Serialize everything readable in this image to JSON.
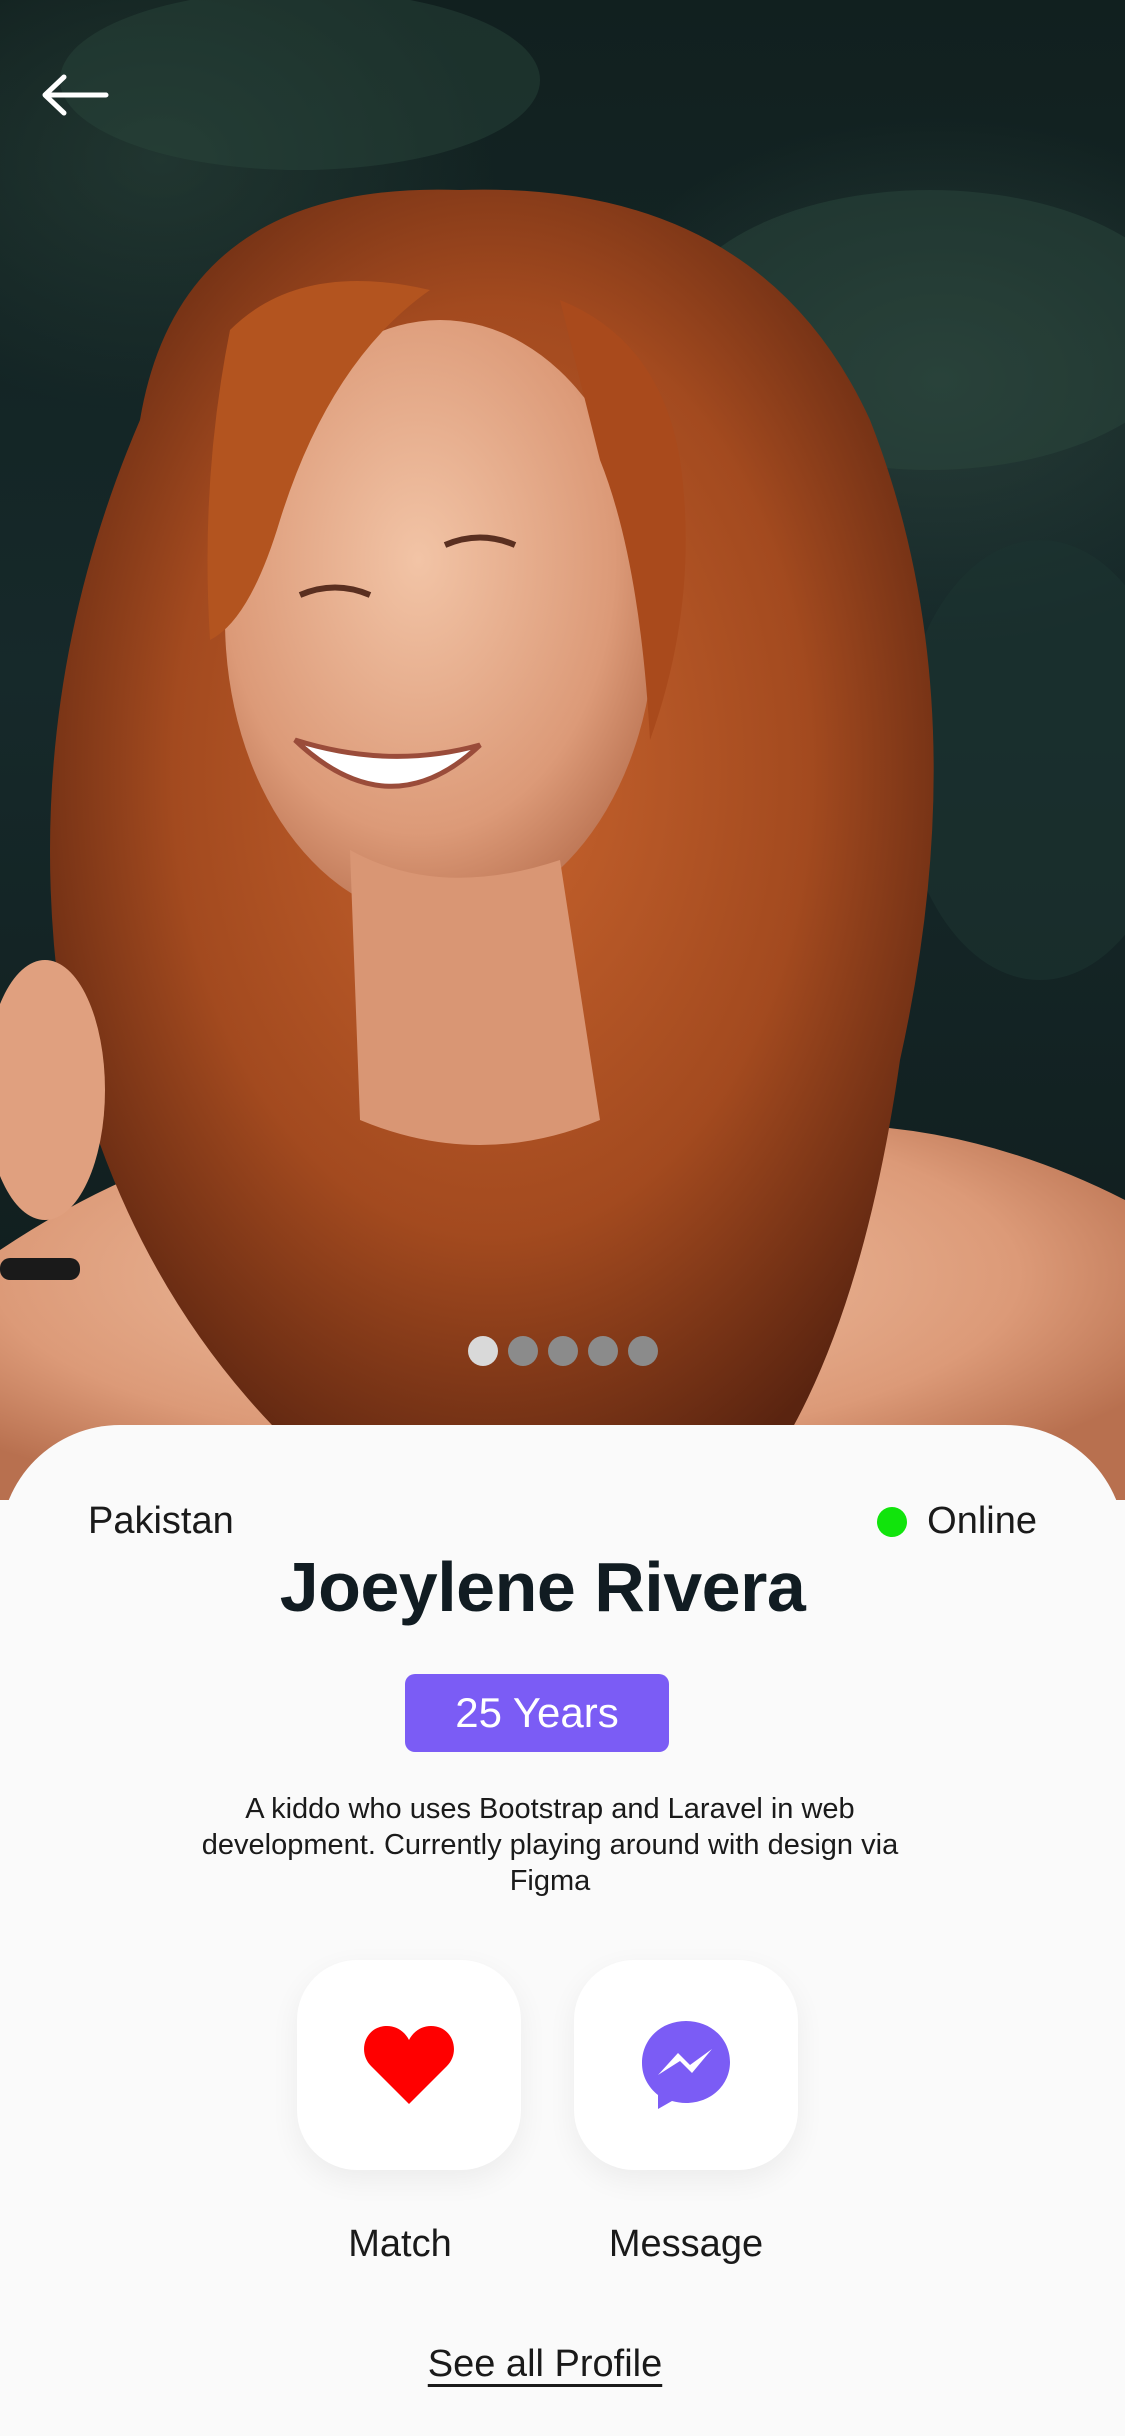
{
  "hero": {
    "back_icon": "arrow-left-icon",
    "carousel": {
      "count": 5,
      "active_index": 0
    }
  },
  "profile": {
    "country": "Pakistan",
    "status": {
      "label": "Online",
      "color": "#11e40c"
    },
    "name": "Joeylene Rivera",
    "age": "25 Years",
    "bio": "A kiddo who uses Bootstrap and Laravel in web development. Currently playing around with design via Figma"
  },
  "actions": {
    "match": {
      "label": "Match",
      "icon": "heart-icon",
      "color": "#ff0000"
    },
    "message": {
      "label": "Message",
      "icon": "messenger-icon",
      "color": "#7b5cf5"
    }
  },
  "footer": {
    "see_all_label": "See all Profile"
  },
  "theme": {
    "accent": "#7b5cf5",
    "background": "#fafafa"
  }
}
